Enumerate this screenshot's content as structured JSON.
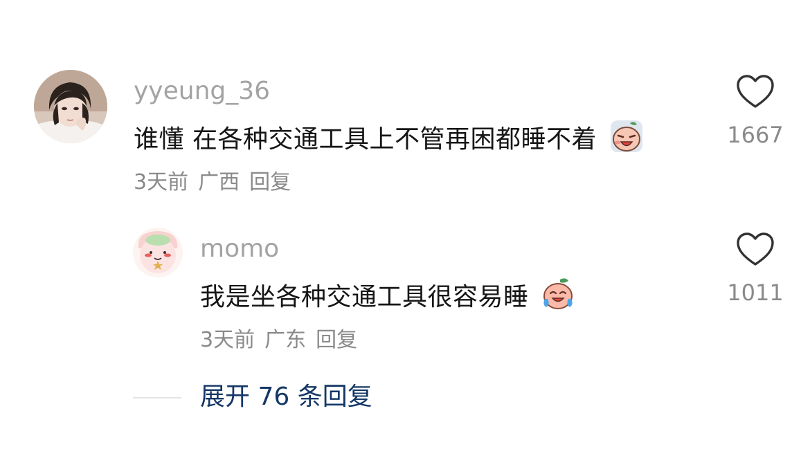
{
  "comments": [
    {
      "username": "yyeung_36",
      "text": "谁懂 在各种交通工具上不管再困都睡不着",
      "time": "3天前",
      "location": "广西",
      "reply_label": "回复",
      "like_count": "1667",
      "emoji_icon": "sleepy-face-emoji-icon"
    },
    {
      "username": "momo",
      "text": "我是坐各种交通工具很容易睡",
      "time": "3天前",
      "location": "广东",
      "reply_label": "回复",
      "like_count": "1011",
      "emoji_icon": "crying-laughing-peach-emoji-icon"
    }
  ],
  "expand_replies": "展开 76 条回复"
}
